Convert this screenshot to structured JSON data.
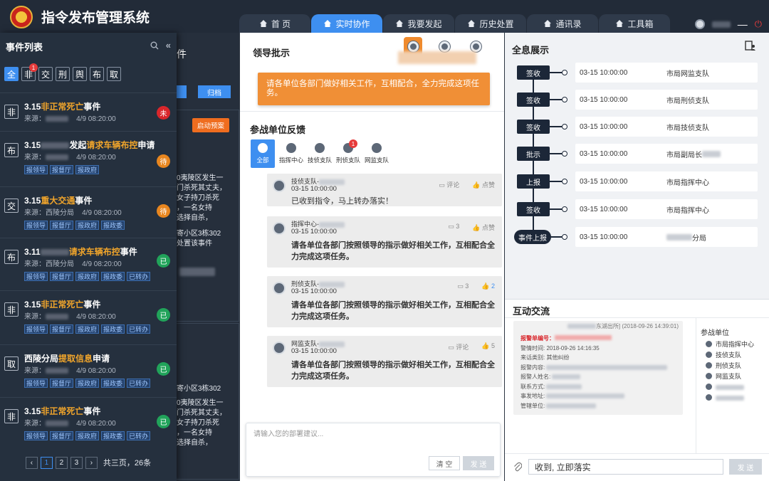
{
  "app": {
    "title": "指令发布管理系统"
  },
  "tabs": [
    {
      "label": "首 页",
      "active": false
    },
    {
      "label": "实时协作",
      "active": true
    },
    {
      "label": "我要发起",
      "active": false
    },
    {
      "label": "历史处置",
      "active": false
    },
    {
      "label": "通讯录",
      "active": false
    },
    {
      "label": "工具箱",
      "active": false
    }
  ],
  "sidebar": {
    "title": "事件列表",
    "filters": [
      "全",
      "非",
      "交",
      "刑",
      "舆",
      "布",
      "取"
    ],
    "filter_badge": "1",
    "events": [
      {
        "type": "非",
        "prefix": "3.15",
        "highlight": "非正常死亡",
        "suffix": "事件",
        "source_label": "来源：",
        "date": "4/9 08:20:00",
        "tags": [
          "报领导",
          "报督厅",
          "报政府"
        ],
        "status": "未",
        "status_color": "#d9262b"
      },
      {
        "type": "布",
        "prefix": "3.15",
        "mid": "发起",
        "highlight": "请求车辆布控",
        "suffix": "申请",
        "source_label": "来源：",
        "date": "4/9 08:20:00",
        "tags": [
          "报领导",
          "报督厅",
          "报政府"
        ],
        "status": "待",
        "status_color": "#e8861f"
      },
      {
        "type": "交",
        "prefix": "3.15",
        "highlight": "重大交通",
        "suffix": "事件",
        "source_label": "来源：西陵分局",
        "date": "4/9 08:20:00",
        "tags": [
          "报领导",
          "报督厅",
          "报政府",
          "报政委"
        ],
        "status": "待",
        "status_color": "#e8861f"
      },
      {
        "type": "布",
        "prefix": "3.11",
        "highlight": "请求车辆布控",
        "suffix": "事件",
        "source_label": "来源：西陵分局",
        "date": "4/9 08:20:00",
        "tags": [
          "报领导",
          "报督厅",
          "报政府",
          "报政委",
          "已转办"
        ],
        "status": "已",
        "status_color": "#21a35a"
      },
      {
        "type": "非",
        "prefix": "3.15",
        "highlight": "非正常死亡",
        "suffix": "事件",
        "source_label": "来源：",
        "date": "4/9 08:20:00",
        "tags": [
          "报领导",
          "报督厅",
          "报政府",
          "报政委",
          "已转办"
        ],
        "status": "已",
        "status_color": "#21a35a"
      },
      {
        "type": "取",
        "prefix": "西陵分局",
        "highlight": "提取信息",
        "suffix": "申请",
        "source_label": "来源：",
        "date": "4/9 08:20:00",
        "tags": [
          "报领导",
          "报督厅",
          "报政府",
          "报政委",
          "已转办"
        ],
        "status": "已",
        "status_color": "#21a35a"
      },
      {
        "type": "非",
        "prefix": "3.15",
        "highlight": "非正常死亡",
        "suffix": "事件",
        "source_label": "来源：",
        "date": "4/9 08:20:00",
        "tags": [
          "报领导",
          "报督厅",
          "报政府",
          "报政委",
          "已转办"
        ],
        "status": "已",
        "status_color": "#21a35a"
      }
    ],
    "pagination": {
      "pages": [
        "1",
        "2",
        "3"
      ],
      "summary": "共三页，26条"
    }
  },
  "background": {
    "button_label": "归档",
    "alert_button": "启动预案",
    "lines": [
      "0夷陵区发生一",
      "门杀死其丈夫，",
      "女子持刀杀死",
      "，一名女持",
      "选择自杀，",
      "寄小区3栋302",
      "处置该事件"
    ],
    "lines2": [
      "寄小区3栋302",
      "0夷陵区发生一",
      "门杀死其丈夫，",
      "女子持刀杀死",
      "，一名女持",
      "选择自杀，"
    ]
  },
  "center": {
    "leader_title": "领导批示",
    "instruction": "请各单位各部门做好相关工作，互相配合，全力完成这项任务。",
    "feedback_title": "参战单位反馈",
    "feed_tabs": [
      "全部",
      "指挥中心",
      "技侦支队",
      "刑侦支队",
      "网监支队"
    ],
    "feed_badge": "1",
    "feedback": [
      {
        "name": "技侦支队-",
        "time": "",
        "msg": "已收到指令，马上转办落实！",
        "comment": "评论",
        "like": "点赞"
      },
      {
        "name": "指挥中心-",
        "time": "03-15 10:00:00",
        "msg": "请各单位各部门按照领导的指示做好相关工作，互相配合全力完成这项任务。",
        "comment": "3",
        "like": "点赞"
      },
      {
        "name": "刑侦支队-",
        "time": "03-15 10:00:00",
        "msg": "请各单位各部门按照领导的指示做好相关工作，互相配合全力完成这项任务。",
        "comment": "3",
        "like": "2"
      },
      {
        "name": "网监支队-",
        "time": "03-15 10:00:00",
        "msg": "请各单位各部门按照领导的指示做好相关工作，互相配合全力完成这项任务。",
        "comment": "评论",
        "like": "5"
      }
    ],
    "feedback0_time": "03-15 10:00:00",
    "suggest_placeholder": "请输入您的部署建议...",
    "clear_label": "清 空",
    "send_label": "发 送"
  },
  "right": {
    "title": "全息展示",
    "timeline": [
      {
        "node": "签收",
        "time": "03-15 10:00:00",
        "unit": "市局网监支队"
      },
      {
        "node": "签收",
        "time": "03-15 10:00:00",
        "unit": "市局刑侦支队"
      },
      {
        "node": "签收",
        "time": "03-15 10:00:00",
        "unit": "市局技侦支队"
      },
      {
        "node": "批示",
        "time": "03-15 10:00:00",
        "unit": "市局副局长"
      },
      {
        "node": "上报",
        "time": "03-15 10:00:00",
        "unit": "市局指挥中心"
      },
      {
        "node": "签收",
        "time": "03-15 10:00:00",
        "unit": "市局指挥中心"
      },
      {
        "node": "事件上报",
        "time": "03-15 10:00:00",
        "unit": "分局"
      }
    ],
    "chat_title": "互动交流",
    "chat_card": {
      "header": "东湖出所] (2018-09-26 14:39:01)",
      "report_label": "报警单编号：",
      "rows": [
        "警情时间: 2018-09-26 14:16:35",
        "来话类别: 其他纠纷",
        "报警内容:",
        "报警人姓名:",
        "联系方式:",
        "事发地址:",
        "管辖单位:"
      ]
    },
    "units_title": "参战单位",
    "units": [
      "市局指挥中心",
      "技侦支队",
      "刑侦支队",
      "网监支队",
      "",
      ""
    ],
    "chat_input": "收到, 立即落实",
    "send_label": "发 送"
  }
}
